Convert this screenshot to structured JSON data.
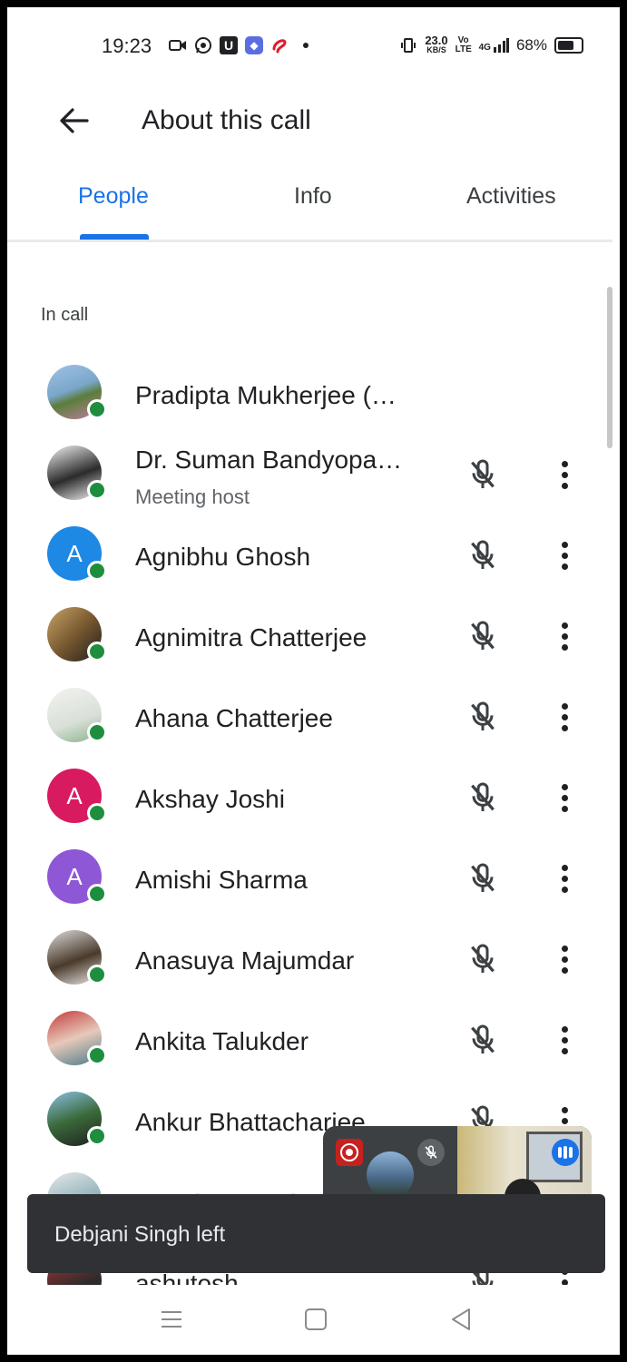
{
  "status_bar": {
    "time": "19:23",
    "net_speed_value": "23.0",
    "net_speed_unit": "KB/S",
    "volte": "Vo LTE",
    "signal": "4G",
    "battery": "68%",
    "icons": [
      "video-icon",
      "whatsapp-icon",
      "u-app-icon",
      "app-icon",
      "airtel-icon",
      "dot-icon",
      "vibrate-icon",
      "signal-icon",
      "battery-icon"
    ]
  },
  "app_bar": {
    "title": "About this call"
  },
  "tabs": [
    {
      "label": "People",
      "active": true
    },
    {
      "label": "Info",
      "active": false
    },
    {
      "label": "Activities",
      "active": false
    }
  ],
  "section_label": "In call",
  "participants": [
    {
      "name": "Pradipta Mukherjee (…",
      "subtitle": "",
      "avatar": "photo",
      "show_controls": false
    },
    {
      "name": "Dr. Suman Bandyopa…",
      "subtitle": "Meeting host",
      "avatar": "photo",
      "show_controls": true
    },
    {
      "name": "Agnibhu Ghosh",
      "subtitle": "",
      "avatar": "letter",
      "letter": "A",
      "color": "#1e88e5",
      "show_controls": true
    },
    {
      "name": "Agnimitra Chatterjee",
      "subtitle": "",
      "avatar": "photo",
      "show_controls": true
    },
    {
      "name": "Ahana Chatterjee",
      "subtitle": "",
      "avatar": "photo",
      "show_controls": true
    },
    {
      "name": "Akshay Joshi",
      "subtitle": "",
      "avatar": "letter",
      "letter": "A",
      "color": "#d81b60",
      "show_controls": true
    },
    {
      "name": "Amishi Sharma",
      "subtitle": "",
      "avatar": "letter",
      "letter": "A",
      "color": "#8e57d6",
      "show_controls": true
    },
    {
      "name": "Anasuya Majumdar",
      "subtitle": "",
      "avatar": "photo",
      "show_controls": true
    },
    {
      "name": "Ankita Talukder",
      "subtitle": "",
      "avatar": "photo",
      "show_controls": true
    },
    {
      "name": "Ankur Bhattacharjee",
      "subtitle": "",
      "avatar": "photo",
      "show_controls": true
    },
    {
      "name": "ANUSHREE GH",
      "subtitle": "",
      "avatar": "photo",
      "show_controls": false
    },
    {
      "name": "ashutosh",
      "subtitle": "",
      "avatar": "photo",
      "show_controls": true
    }
  ],
  "toast": {
    "text": "Debjani Singh left"
  },
  "nav_bar": [
    "menu-icon",
    "home-icon",
    "back-triangle-icon"
  ]
}
